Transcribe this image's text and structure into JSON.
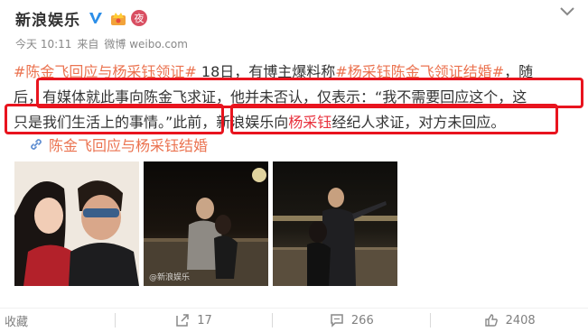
{
  "post": {
    "author": "新浪娱乐",
    "badge_ye": "夜",
    "time": "今天 10:11",
    "source_label": "来自",
    "source": "微博 weibo.com",
    "topic_tag": "#陈金飞回应与杨采钰领证#",
    "line1_rest": " 18日，有博主爆料称",
    "topic_tag2": "#杨采钰陈金飞领证结婚#",
    "line1_end": "，随",
    "line2": "后，有媒体就此事向陈金飞求证，他并未否认，仅表示：“我不需要回应这个，这",
    "line3_a": "只是我们生活上的事情。”此前，新浪娱乐向",
    "line3_red": "杨采钰",
    "line3_b": "经纪人求证，对方未回应。",
    "link_text": "陈金飞回应与杨采钰结婚",
    "photo_watermark": "@新浪娱乐"
  },
  "actions": {
    "favorite_label": "收藏",
    "repost_count": "17",
    "comment_count": "266",
    "like_count": "2408"
  },
  "colors": {
    "topic": "#eb7350",
    "highlight_box": "#e8141e",
    "name_red": "#e8323e"
  },
  "icons": [
    "verified-v-icon",
    "crown-badge-icon",
    "chevron-down-icon",
    "link-icon",
    "repost-icon",
    "comment-icon",
    "like-icon"
  ]
}
